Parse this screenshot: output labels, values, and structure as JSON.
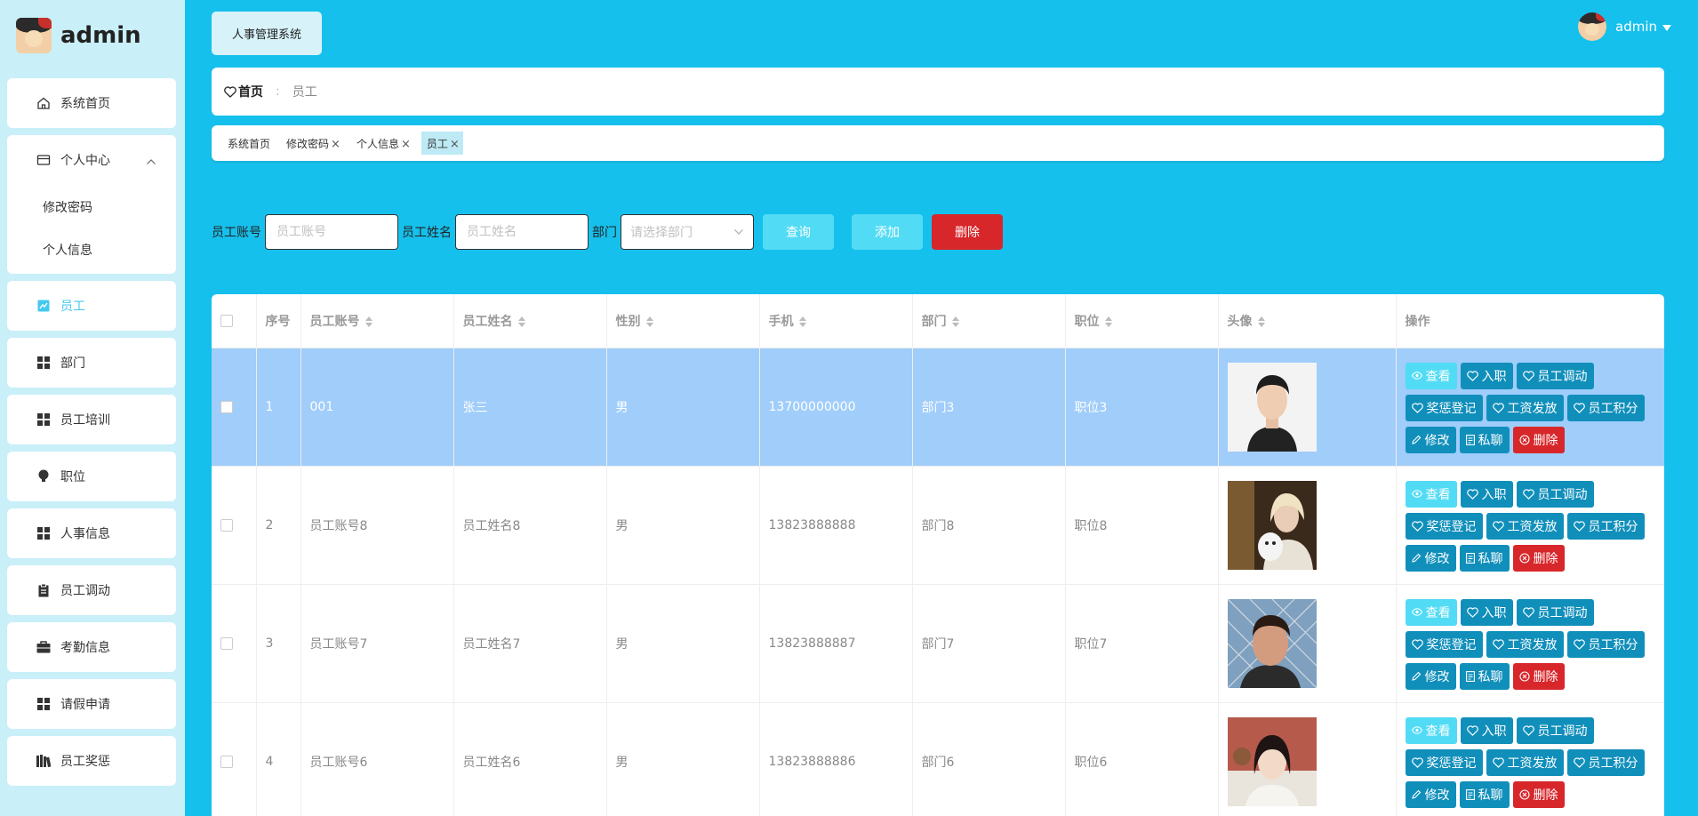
{
  "brand": {
    "name": "admin"
  },
  "sidebar": {
    "items": [
      {
        "label": "系统首页",
        "icon": "home-icon"
      },
      {
        "label": "个人中心",
        "icon": "card-icon",
        "children": [
          {
            "label": "修改密码"
          },
          {
            "label": "个人信息"
          }
        ]
      },
      {
        "label": "员工",
        "icon": "chart-icon"
      },
      {
        "label": "部门",
        "icon": "grid-icon"
      },
      {
        "label": "员工培训",
        "icon": "grid-icon"
      },
      {
        "label": "职位",
        "icon": "bulb-icon"
      },
      {
        "label": "人事信息",
        "icon": "grid-icon"
      },
      {
        "label": "员工调动",
        "icon": "clipboard-icon"
      },
      {
        "label": "考勤信息",
        "icon": "briefcase-icon"
      },
      {
        "label": "请假申请",
        "icon": "grid-icon"
      },
      {
        "label": "员工奖惩",
        "icon": "book-icon"
      }
    ]
  },
  "header": {
    "system_tab": "人事管理系统",
    "user": "admin"
  },
  "breadcrumb": {
    "home": "首页",
    "sep": ":",
    "current": "员工"
  },
  "tags": [
    {
      "label": "系统首页"
    },
    {
      "label": "修改密码",
      "close": "×"
    },
    {
      "label": "个人信息",
      "close": "×"
    },
    {
      "label": "员工",
      "close": "×"
    }
  ],
  "search": {
    "account_label": "员工账号",
    "account_placeholder": "员工账号",
    "name_label": "员工姓名",
    "name_placeholder": "员工姓名",
    "dept_label": "部门",
    "dept_placeholder": "请选择部门",
    "query_btn": "查询",
    "add_btn": "添加",
    "delete_btn": "删除"
  },
  "table": {
    "columns": [
      "序号",
      "员工账号",
      "员工姓名",
      "性别",
      "手机",
      "部门",
      "职位",
      "头像",
      "操作"
    ],
    "rows": [
      {
        "index": "1",
        "account": "001",
        "name": "张三",
        "gender": "男",
        "phone": "13700000000",
        "dept": "部门3",
        "position": "职位3"
      },
      {
        "index": "2",
        "account": "员工账号8",
        "name": "员工姓名8",
        "gender": "男",
        "phone": "13823888888",
        "dept": "部门8",
        "position": "职位8"
      },
      {
        "index": "3",
        "account": "员工账号7",
        "name": "员工姓名7",
        "gender": "男",
        "phone": "13823888887",
        "dept": "部门7",
        "position": "职位7"
      },
      {
        "index": "4",
        "account": "员工账号6",
        "name": "员工姓名6",
        "gender": "男",
        "phone": "13823888886",
        "dept": "部门6",
        "position": "职位6"
      }
    ],
    "actions": {
      "view": "查看",
      "onboard": "入职",
      "transfer": "员工调动",
      "reward": "奖惩登记",
      "salary": "工资发放",
      "points": "员工积分",
      "edit": "修改",
      "chat": "私聊",
      "delete": "删除"
    }
  }
}
